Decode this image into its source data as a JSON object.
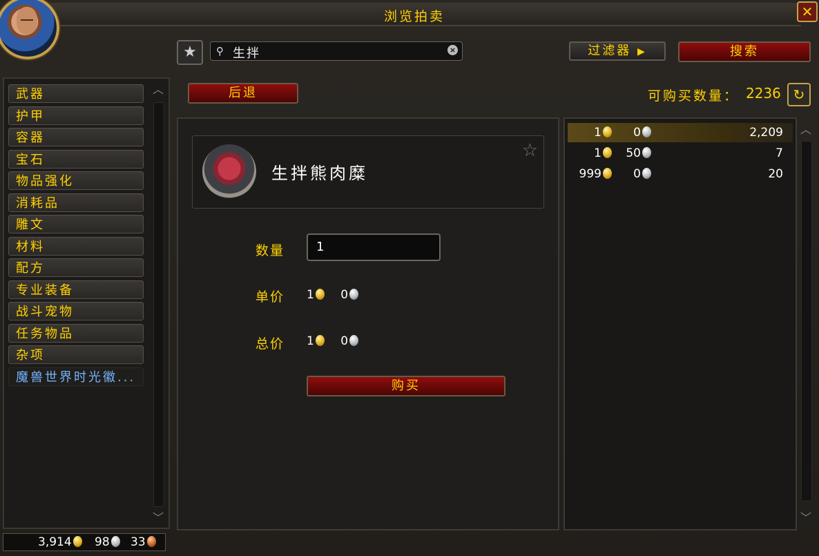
{
  "window": {
    "title": "浏览拍卖",
    "close_label": "✕"
  },
  "search": {
    "query": "生拌",
    "star_icon": "star-icon"
  },
  "toolbar": {
    "filter_label": "过滤器",
    "search_label": "搜索",
    "back_label": "后退"
  },
  "availability": {
    "label": "可购买数量：",
    "count": "2236"
  },
  "categories": [
    "武器",
    "护甲",
    "容器",
    "宝石",
    "物品强化",
    "消耗品",
    "雕文",
    "材料",
    "配方",
    "专业装备",
    "战斗宠物",
    "任务物品",
    "杂项",
    "魔兽世界时光徽..."
  ],
  "money": {
    "gold": "3,914",
    "silver": "98",
    "copper": "33"
  },
  "item": {
    "name": "生拌熊肉糜",
    "quantity_label": "数量",
    "quantity_value": "1",
    "unit_price_label": "单价",
    "unit_price_gold": "1",
    "unit_price_silver": "0",
    "total_price_label": "总价",
    "total_price_gold": "1",
    "total_price_silver": "0",
    "buy_label": "购买"
  },
  "listings": [
    {
      "gold": "1",
      "silver": "0",
      "available": "2,209"
    },
    {
      "gold": "1",
      "silver": "50",
      "available": "7"
    },
    {
      "gold": "999",
      "silver": "0",
      "available": "20"
    }
  ],
  "colors": {
    "accent_gold": "#ffd100",
    "selected_category": "#72b3ff",
    "button_red": "#8f0d0d"
  }
}
